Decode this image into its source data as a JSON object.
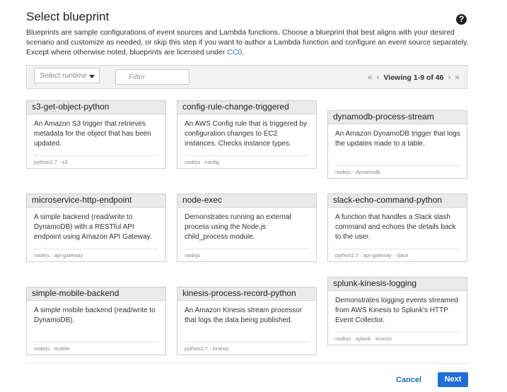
{
  "header": {
    "title": "Select blueprint",
    "help_icon": "?",
    "description": "Blueprints are sample configurations of event sources and Lambda functions. Choose a blueprint that best aligns with your desired scenario and customize as needed, or skip this step if you want to author a Lambda function and configure an event source separately. Except where otherwise noted, blueprints are licensed under",
    "license_link": "CC0",
    "license_suffix": "."
  },
  "toolbar": {
    "runtime_placeholder": "Select runtime",
    "filter_placeholder": "Filter",
    "pager_text": "Viewing 1-9 of 46",
    "first_icon": "«",
    "prev_icon": "‹",
    "next_icon": "›",
    "last_icon": "»"
  },
  "cards": [
    {
      "title": "s3-get-object-python",
      "description": "An Amazon S3 trigger that retrieves metadata for the object that has been updated.",
      "tags": "python2.7 · s3"
    },
    {
      "title": "config-rule-change-triggered",
      "description": "An AWS Config rule that is triggered by configuration changes to EC2 instances. Checks instance types.",
      "tags": "nodejs · config"
    },
    {
      "title": "dynamodb-process-stream",
      "description": "An Amazon DynamoDB trigger that logs the updates made to a table.",
      "tags": "nodejs · dynamodb"
    },
    {
      "title": "microservice-http-endpoint",
      "description": "A simple backend (read/write to DynamoDB) with a RESTful API endpoint using Amazon API Gateway.",
      "tags": "nodejs · api-gateway"
    },
    {
      "title": "node-exec",
      "description": "Demonstrates running an external process using the Node.js child_process module.",
      "tags": "nodejs"
    },
    {
      "title": "slack-echo-command-python",
      "description": "A function that handles a Slack slash command and echoes the details back to the user.",
      "tags": "python2.7 · api-gateway · slack"
    },
    {
      "title": "simple-mobile-backend",
      "description": "A simple mobile backend (read/write to DynamoDB).",
      "tags": "nodejs · mobile"
    },
    {
      "title": "kinesis-process-record-python",
      "description": "An Amazon Kinesis stream processor that logs the data being published.",
      "tags": "python2.7 · kinesis"
    },
    {
      "title": "splunk-kinesis-logging",
      "description": "Demonstrates logging events streamed from AWS Kinesis to Splunk's HTTP Event Collector.",
      "tags": "nodejs · splunk · kinesis"
    }
  ],
  "footer": {
    "cancel_label": "Cancel",
    "next_label": "Next"
  }
}
